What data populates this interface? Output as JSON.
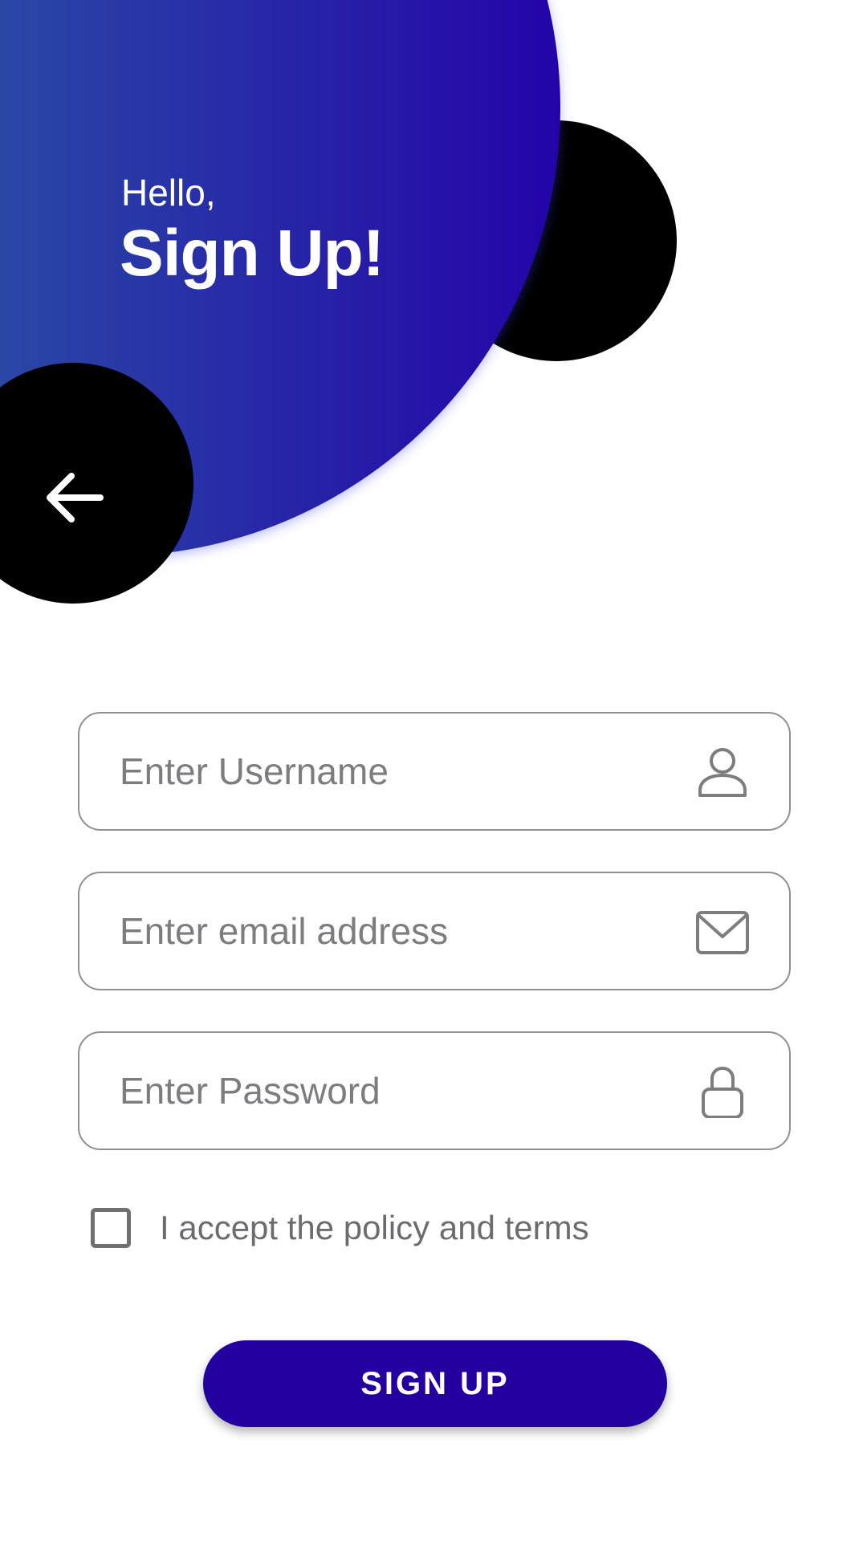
{
  "header": {
    "greeting": "Hello,",
    "title": "Sign Up!"
  },
  "icons": {
    "back": "arrow-left-icon",
    "username": "user-icon",
    "email": "mail-icon",
    "password": "lock-icon"
  },
  "form": {
    "username": {
      "value": "",
      "placeholder": "Enter Username"
    },
    "email": {
      "value": "",
      "placeholder": "Enter email address"
    },
    "password": {
      "value": "",
      "placeholder": "Enter Password"
    },
    "terms": {
      "label": "I accept the policy and terms",
      "checked": false
    },
    "submit_label": "SIGN UP"
  },
  "colors": {
    "primary": "#2400a0",
    "gradient_start": "#2a4aa6",
    "gradient_end": "#2404a8",
    "accent_circle": "#000000",
    "field_border": "#8f8f94",
    "placeholder": "#7d7d80"
  }
}
